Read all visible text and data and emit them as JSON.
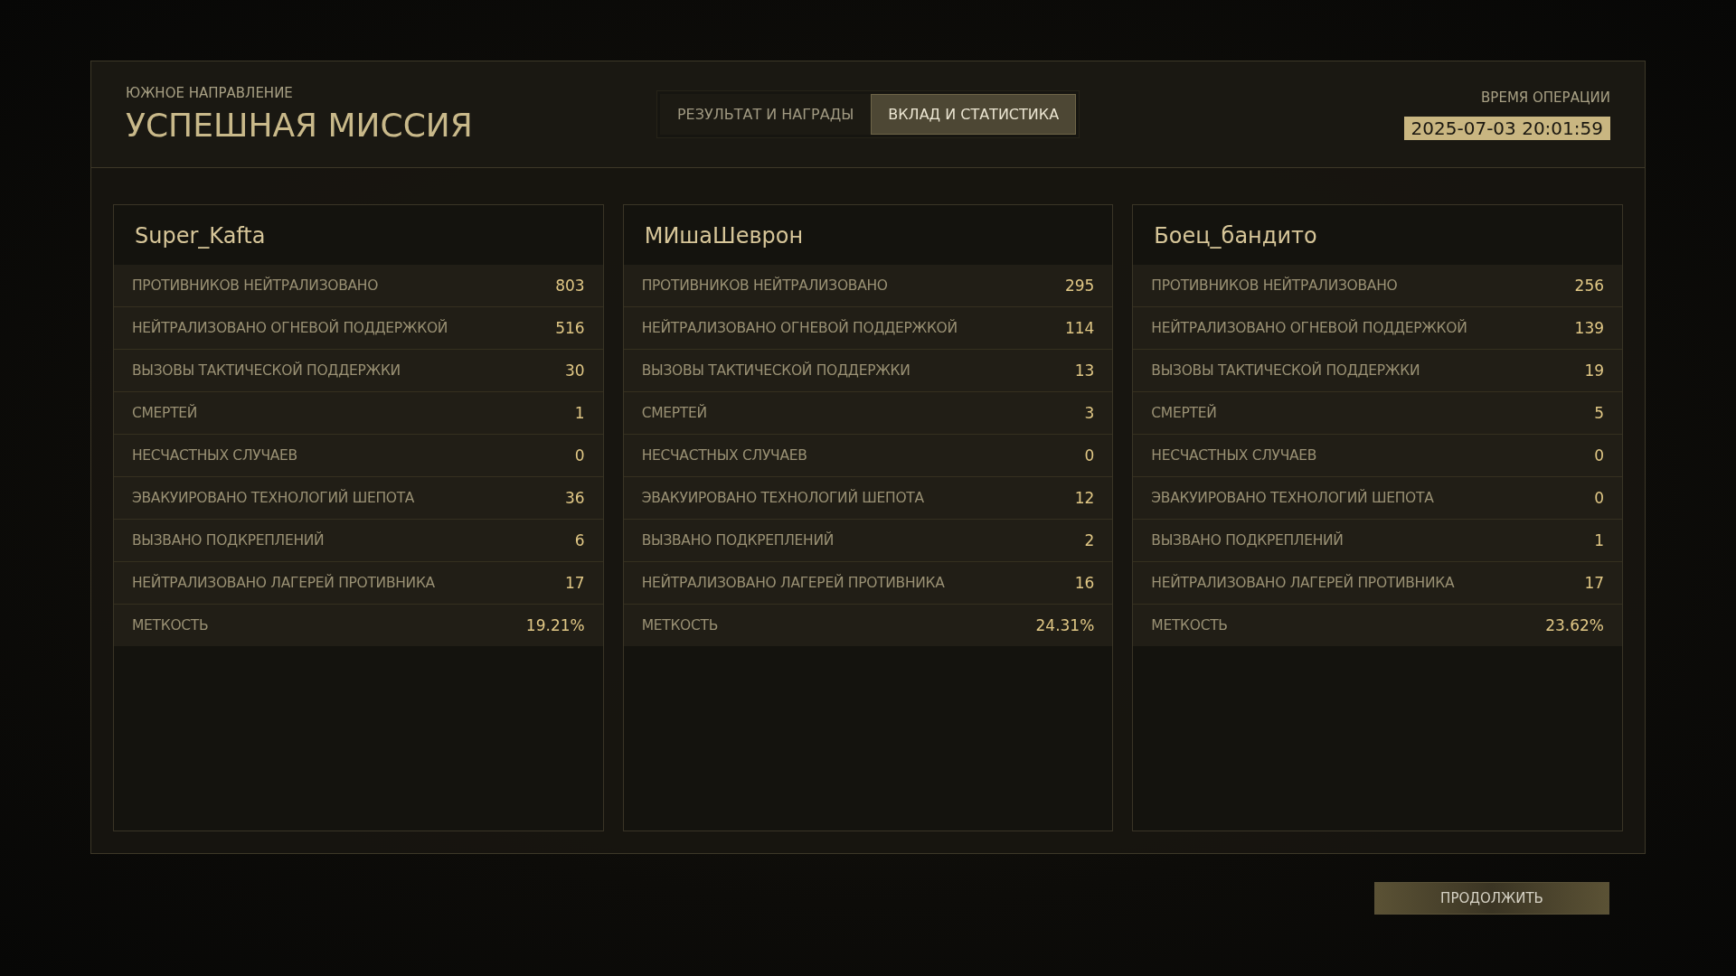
{
  "header": {
    "subtitle": "ЮЖНОЕ НАПРАВЛЕНИЕ",
    "title": "УСПЕШНАЯ МИССИЯ",
    "time_label": "ВРЕМЯ ОПЕРАЦИИ",
    "time_value": "2025-07-03 20:01:59"
  },
  "tabs": [
    {
      "label": "РЕЗУЛЬТАТ И НАГРАДЫ",
      "selected": false
    },
    {
      "label": "ВКЛАД И СТАТИСТИКА",
      "selected": true
    }
  ],
  "players": [
    {
      "name": "Super_Kafta",
      "stats": [
        {
          "label": "ПРОТИВНИКОВ НЕЙТРАЛИЗОВАНО",
          "value": "803"
        },
        {
          "label": "НЕЙТРАЛИЗОВАНО ОГНЕВОЙ ПОДДЕРЖКОЙ",
          "value": "516"
        },
        {
          "label": "ВЫЗОВЫ ТАКТИЧЕСКОЙ ПОДДЕРЖКИ",
          "value": "30"
        },
        {
          "label": "СМЕРТЕЙ",
          "value": "1"
        },
        {
          "label": "НЕСЧАСТНЫХ СЛУЧАЕВ",
          "value": "0"
        },
        {
          "label": "ЭВАКУИРОВАНО ТЕХНОЛОГИЙ ШЕПОТА",
          "value": "36"
        },
        {
          "label": "ВЫЗВАНО ПОДКРЕПЛЕНИЙ",
          "value": "6"
        },
        {
          "label": "НЕЙТРАЛИЗОВАНО ЛАГЕРЕЙ ПРОТИВНИКА",
          "value": "17"
        },
        {
          "label": "МЕТКОСТЬ",
          "value": "19.21%"
        }
      ]
    },
    {
      "name": "МИшаШеврон",
      "stats": [
        {
          "label": "ПРОТИВНИКОВ НЕЙТРАЛИЗОВАНО",
          "value": "295"
        },
        {
          "label": "НЕЙТРАЛИЗОВАНО ОГНЕВОЙ ПОДДЕРЖКОЙ",
          "value": "114"
        },
        {
          "label": "ВЫЗОВЫ ТАКТИЧЕСКОЙ ПОДДЕРЖКИ",
          "value": "13"
        },
        {
          "label": "СМЕРТЕЙ",
          "value": "3"
        },
        {
          "label": "НЕСЧАСТНЫХ СЛУЧАЕВ",
          "value": "0"
        },
        {
          "label": "ЭВАКУИРОВАНО ТЕХНОЛОГИЙ ШЕПОТА",
          "value": "12"
        },
        {
          "label": "ВЫЗВАНО ПОДКРЕПЛЕНИЙ",
          "value": "2"
        },
        {
          "label": "НЕЙТРАЛИЗОВАНО ЛАГЕРЕЙ ПРОТИВНИКА",
          "value": "16"
        },
        {
          "label": "МЕТКОСТЬ",
          "value": "24.31%"
        }
      ]
    },
    {
      "name": "Боец_бандито",
      "stats": [
        {
          "label": "ПРОТИВНИКОВ НЕЙТРАЛИЗОВАНО",
          "value": "256"
        },
        {
          "label": "НЕЙТРАЛИЗОВАНО ОГНЕВОЙ ПОДДЕРЖКОЙ",
          "value": "139"
        },
        {
          "label": "ВЫЗОВЫ ТАКТИЧЕСКОЙ ПОДДЕРЖКИ",
          "value": "19"
        },
        {
          "label": "СМЕРТЕЙ",
          "value": "5"
        },
        {
          "label": "НЕСЧАСТНЫХ СЛУЧАЕВ",
          "value": "0"
        },
        {
          "label": "ЭВАКУИРОВАНО ТЕХНОЛОГИЙ ШЕПОТА",
          "value": "0"
        },
        {
          "label": "ВЫЗВАНО ПОДКРЕПЛЕНИЙ",
          "value": "1"
        },
        {
          "label": "НЕЙТРАЛИЗОВАНО ЛАГЕРЕЙ ПРОТИВНИКА",
          "value": "17"
        },
        {
          "label": "МЕТКОСТЬ",
          "value": "23.62%"
        }
      ]
    }
  ],
  "continue_button": "ПРОДОЛЖИТЬ"
}
